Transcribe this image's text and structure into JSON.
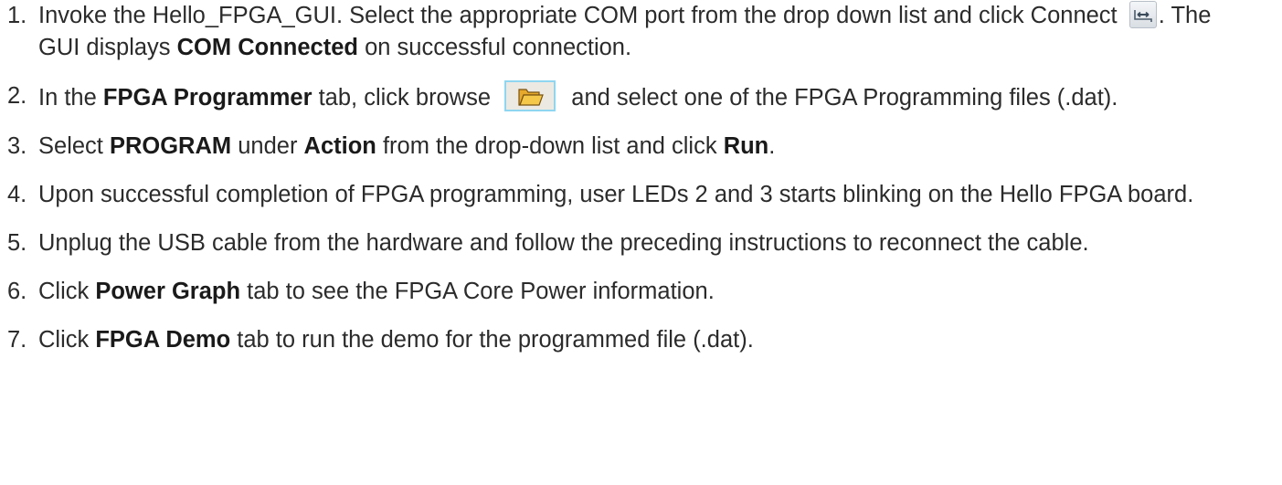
{
  "steps": [
    {
      "number": "1.",
      "parts": [
        {
          "t": "text",
          "v": "Invoke the Hello_FPGA_GUI. Select the appropriate COM port from the drop down list and click Connect "
        },
        {
          "t": "icon",
          "v": "connect-icon"
        },
        {
          "t": "text",
          "v": ". The GUI displays "
        },
        {
          "t": "bold",
          "v": "COM Connected"
        },
        {
          "t": "text",
          "v": " on successful connection."
        }
      ]
    },
    {
      "number": "2.",
      "parts": [
        {
          "t": "text",
          "v": "In the "
        },
        {
          "t": "bold",
          "v": "FPGA Programmer"
        },
        {
          "t": "text",
          "v": " tab, click browse "
        },
        {
          "t": "icon",
          "v": "folder-open-icon"
        },
        {
          "t": "text",
          "v": " and select one of the FPGA Programming files (.dat)."
        }
      ]
    },
    {
      "number": "3.",
      "parts": [
        {
          "t": "text",
          "v": "Select "
        },
        {
          "t": "bold",
          "v": "PROGRAM"
        },
        {
          "t": "text",
          "v": " under "
        },
        {
          "t": "bold",
          "v": "Action"
        },
        {
          "t": "text",
          "v": " from the drop-down list and click "
        },
        {
          "t": "bold",
          "v": "Run"
        },
        {
          "t": "text",
          "v": "."
        }
      ]
    },
    {
      "number": "4.",
      "parts": [
        {
          "t": "text",
          "v": "Upon successful completion of FPGA programming, user LEDs 2 and 3 starts blinking on the Hello FPGA board."
        }
      ]
    },
    {
      "number": "5.",
      "parts": [
        {
          "t": "text",
          "v": "Unplug the USB cable from the hardware and follow the preceding instructions to reconnect the cable."
        }
      ]
    },
    {
      "number": "6.",
      "parts": [
        {
          "t": "text",
          "v": "Click "
        },
        {
          "t": "bold",
          "v": "Power Graph"
        },
        {
          "t": "text",
          "v": " tab to see the FPGA Core Power information."
        }
      ]
    },
    {
      "number": "7.",
      "parts": [
        {
          "t": "text",
          "v": "Click "
        },
        {
          "t": "bold",
          "v": "FPGA Demo"
        },
        {
          "t": "text",
          "v": " tab to run the demo for the programmed file (.dat)."
        }
      ]
    }
  ]
}
